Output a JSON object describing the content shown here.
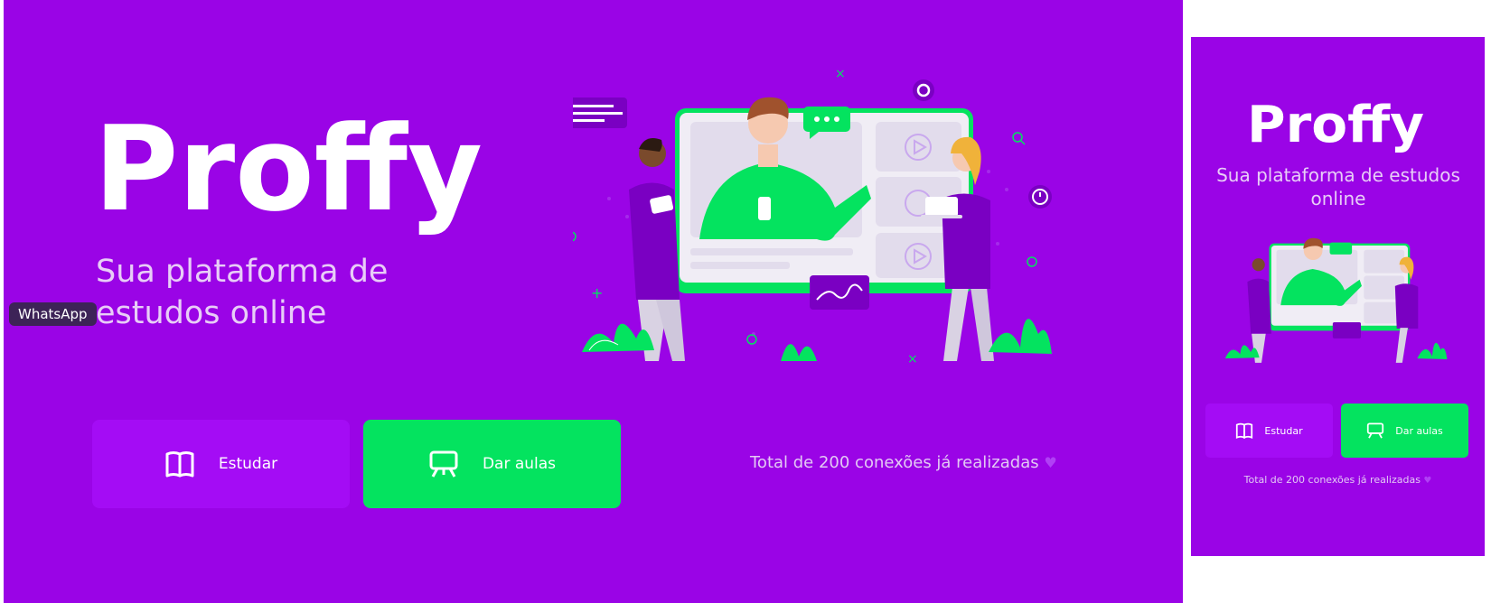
{
  "brand": {
    "name": "Proffy"
  },
  "hero": {
    "tagline_line1": "Sua plataforma de",
    "tagline_line2": "estudos online"
  },
  "buttons": {
    "study_label": "Estudar",
    "teach_label": "Dar aulas"
  },
  "stats": {
    "total_connections": "Total de 200 conexões já realizadas"
  },
  "tooltip": {
    "whatsapp": "WhatsApp"
  },
  "mobile": {
    "tagline": "Sua plataforma de estudos online"
  },
  "colors": {
    "background": "#9a04e6",
    "study_button": "#a40cf5",
    "teach_button": "#04e35f",
    "accent_green": "#04e35f",
    "text_light": "#e8cdf7"
  },
  "icons": {
    "study": "book-open-icon",
    "teach": "presentation-board-icon",
    "heart": "purple-heart-icon"
  }
}
